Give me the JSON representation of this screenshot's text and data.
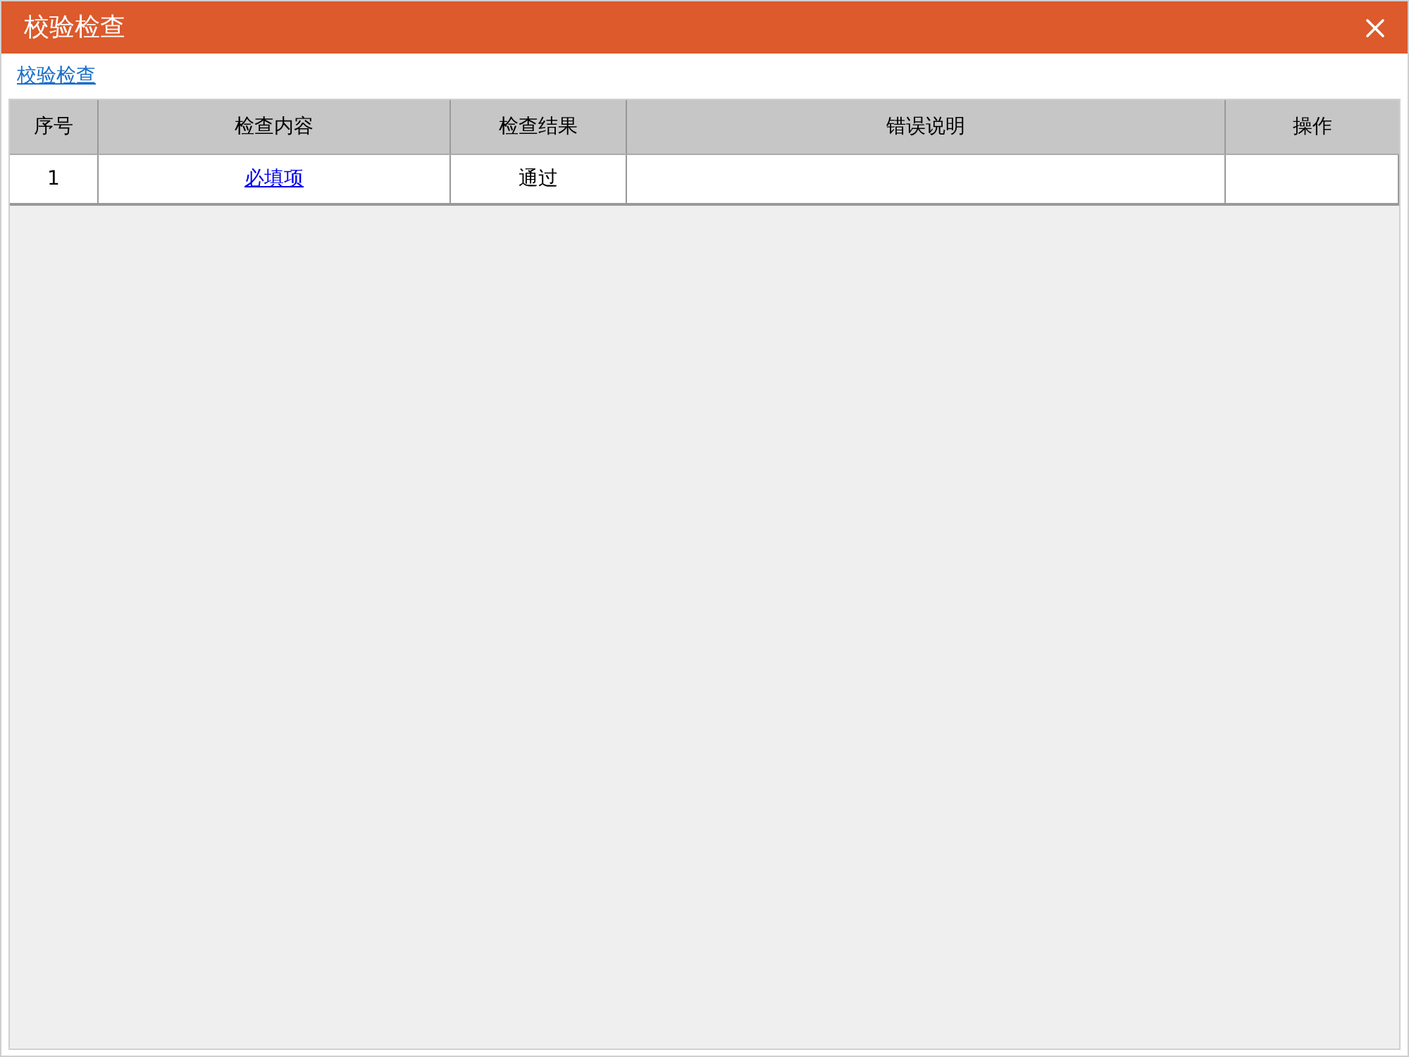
{
  "window": {
    "title": "校验检查"
  },
  "link": "校验检查",
  "table": {
    "columns": [
      "序号",
      "检查内容",
      "检查结果",
      "错误说明",
      "操作"
    ],
    "rows": [
      {
        "index": "1",
        "content": "必填项",
        "result": "通过"
      }
    ]
  }
}
